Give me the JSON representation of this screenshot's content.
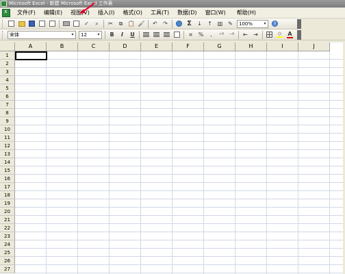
{
  "window": {
    "title": "Microsoft Excel - 新建 Microsoft Excel 工作表"
  },
  "menubar": {
    "items": [
      {
        "label": "文件(F)",
        "name": "menu-file"
      },
      {
        "label": "编辑(E)",
        "name": "menu-edit"
      },
      {
        "label": "视图(V)",
        "name": "menu-view"
      },
      {
        "label": "插入(I)",
        "name": "menu-insert"
      },
      {
        "label": "格式(O)",
        "name": "menu-format"
      },
      {
        "label": "工具(T)",
        "name": "menu-tools"
      },
      {
        "label": "数据(D)",
        "name": "menu-data"
      },
      {
        "label": "窗口(W)",
        "name": "menu-window"
      },
      {
        "label": "帮助(H)",
        "name": "menu-help"
      }
    ]
  },
  "standard_toolbar": {
    "zoom": "100%",
    "sigma_label": "Σ"
  },
  "formatting_toolbar": {
    "font": "宋体",
    "size": "12",
    "bold": "B",
    "italic": "I",
    "underline": "U",
    "percent": "%",
    "comma": ",",
    "font_color_label": "A"
  },
  "sheet": {
    "columns": [
      "A",
      "B",
      "C",
      "D",
      "E",
      "F",
      "G",
      "H",
      "I",
      "J"
    ],
    "rows": [
      "1",
      "2",
      "3",
      "4",
      "5",
      "6",
      "7",
      "8",
      "9",
      "10",
      "11",
      "12",
      "13",
      "14",
      "15",
      "16",
      "17",
      "18",
      "19",
      "20",
      "21",
      "22",
      "23",
      "24",
      "25",
      "26",
      "27"
    ]
  },
  "colors": {
    "title_bar": "#8c8c8c",
    "grid_line": "#d0d7e5",
    "header_bg": "#ece9d8",
    "annotation_arrow": "#e0002a",
    "font_color": "#e00000",
    "fill_color": "#ffff00"
  }
}
